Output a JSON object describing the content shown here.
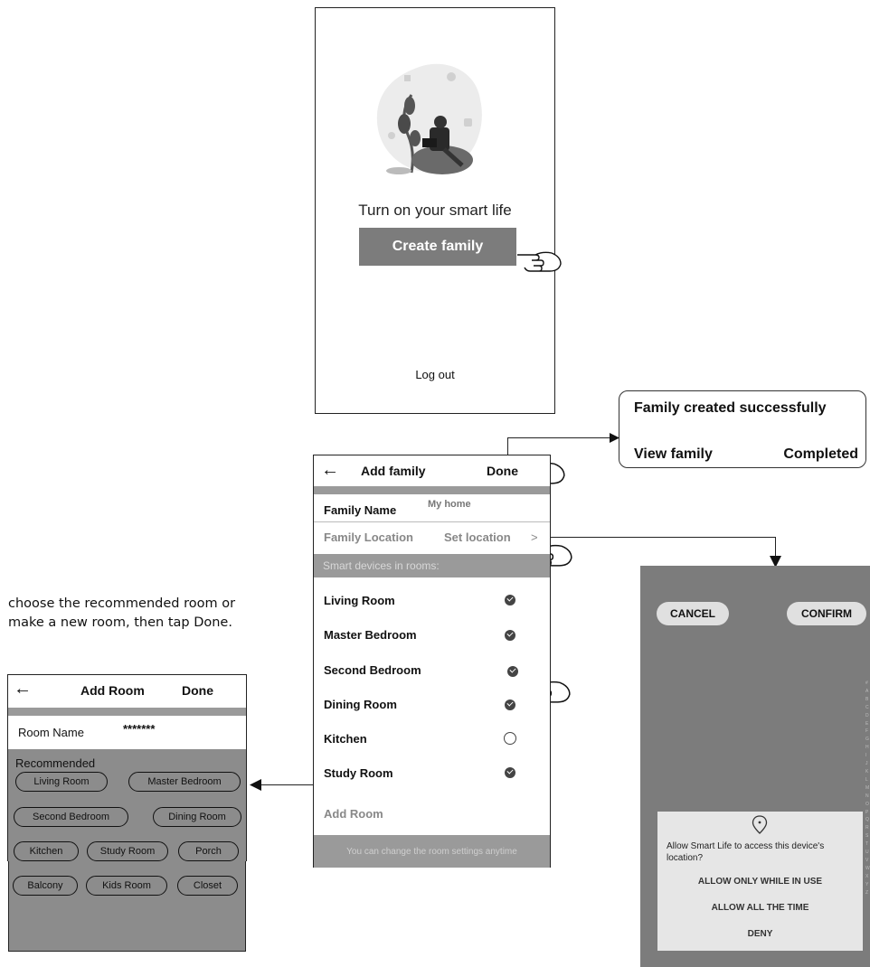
{
  "screen_welcome": {
    "tagline": "Turn on your smart life",
    "create_family_label": "Create family",
    "logout_label": "Log out"
  },
  "popup": {
    "title": "Family created successfully",
    "view_family_label": "View family",
    "completed_label": "Completed"
  },
  "add_family": {
    "back_icon": "←",
    "title": "Add family",
    "done_label": "Done",
    "family_name_label": "Family Name",
    "family_name_value": "My home",
    "family_location_label": "Family Location",
    "set_location_label": "Set location",
    "chevron": ">",
    "section_label": "Smart devices in rooms:",
    "rooms": [
      {
        "name": "Living Room",
        "checked": true
      },
      {
        "name": "Master Bedroom",
        "checked": true
      },
      {
        "name": "Second Bedroom",
        "checked": true
      },
      {
        "name": "Dining Room",
        "checked": true
      },
      {
        "name": "Kitchen",
        "checked": false
      },
      {
        "name": "Study Room",
        "checked": true
      }
    ],
    "add_room_label": "Add Room",
    "footer_note": "You can change the room settings anytime"
  },
  "instruction": "choose the recommended room or make a new room, then tap Done.",
  "add_room": {
    "back_icon": "←",
    "title": "Add Room",
    "done_label": "Done",
    "room_name_label": "Room Name",
    "room_name_value": "*******",
    "recommended_label": "Recommended",
    "recommended": [
      "Living Room",
      "Master Bedroom",
      "Second Bedroom",
      "Dining Room",
      "Kitchen",
      "Study Room",
      "Porch",
      "Balcony",
      "Kids Room",
      "Closet"
    ]
  },
  "location_picker": {
    "cancel_label": "CANCEL",
    "confirm_label": "CONFIRM",
    "alphabet": [
      "#",
      "A",
      "B",
      "C",
      "D",
      "E",
      "F",
      "G",
      "H",
      "I",
      "J",
      "K",
      "L",
      "M",
      "N",
      "O",
      "P",
      "Q",
      "R",
      "S",
      "T",
      "U",
      "V",
      "W",
      "X",
      "Y",
      "Z"
    ],
    "permission_question": "Allow Smart Life to access this device's location?",
    "option_while_in_use": "ALLOW  ONLY WHILE IN USE",
    "option_all_time": "ALLOW  ALL THE TIME",
    "option_deny": "DENY"
  }
}
